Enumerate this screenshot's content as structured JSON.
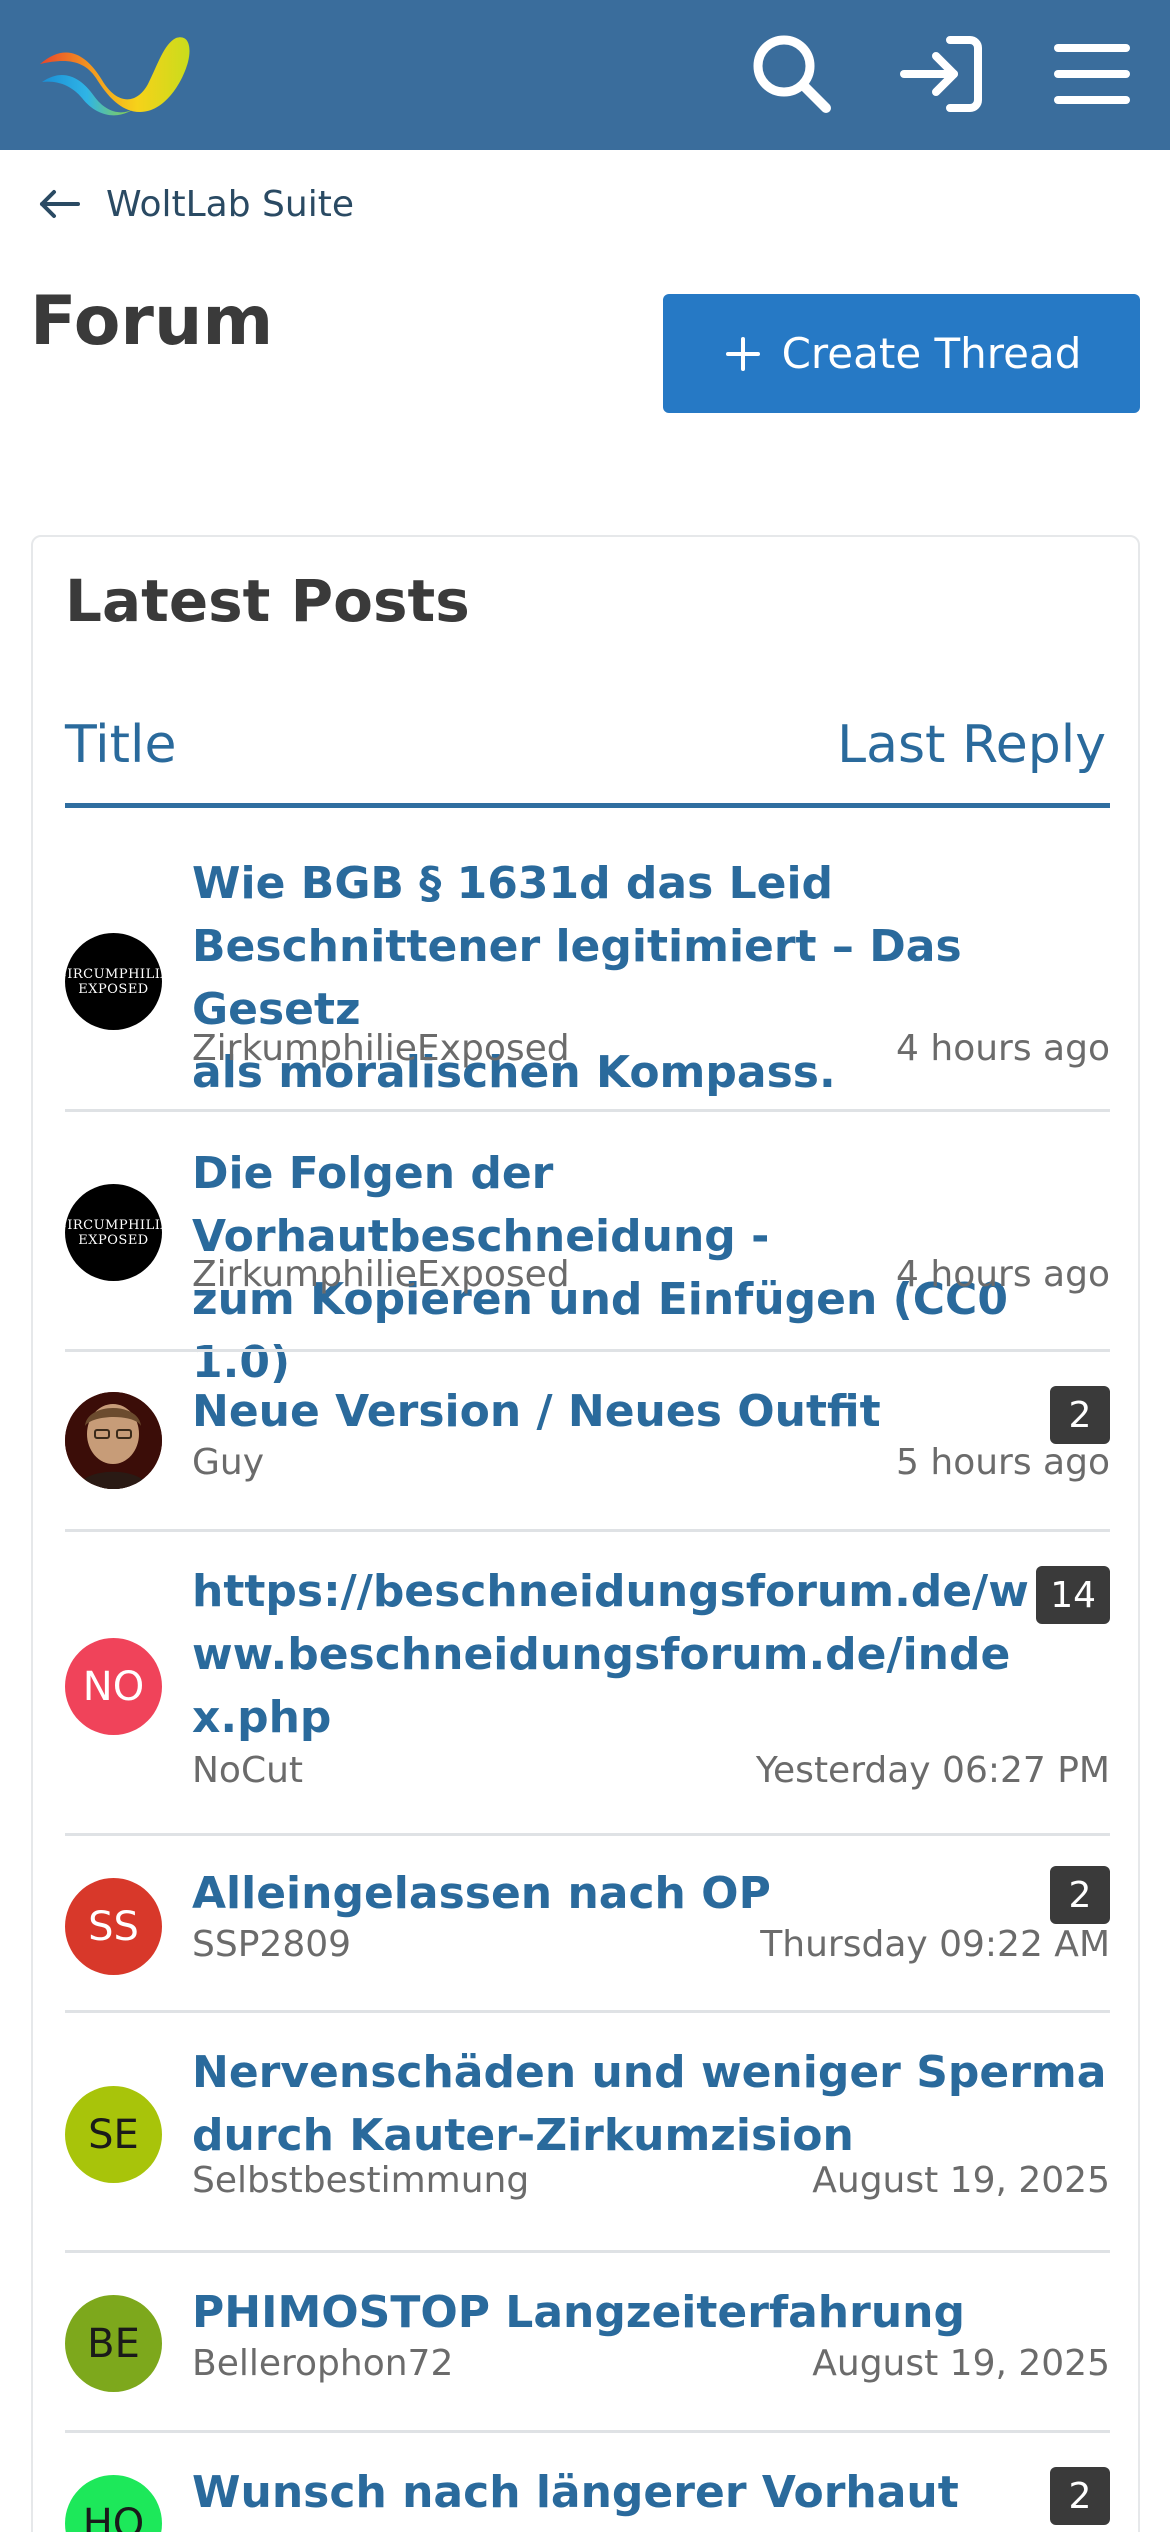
{
  "header": {
    "icons": {
      "logo": "woltlab-logo",
      "search": "search-icon",
      "login": "login-icon",
      "menu": "menu-icon"
    },
    "background_color": "#3a6d9c"
  },
  "breadcrumb": {
    "label": "WoltLab Suite",
    "icon": "arrow-left-icon"
  },
  "page": {
    "title": "Forum",
    "create_button": {
      "label": "Create Thread",
      "icon": "plus-icon",
      "color": "#2679c5"
    }
  },
  "latest_posts": {
    "heading": "Latest Posts",
    "columns": {
      "title": "Title",
      "last_reply": "Last Reply"
    },
    "threads": [
      {
        "title_lines": [
          "Wie BGB § 1631d das Leid",
          "Beschnittener legitimiert – Das Gesetz",
          "als moralischen Kompass."
        ],
        "author": "ZirkumphilieExposed",
        "time": "4 hours ago",
        "replies": "",
        "avatar": {
          "type": "logo",
          "line1": "CIRCUMPHILIA",
          "line2": "EXPOSED"
        }
      },
      {
        "title_lines": [
          "Die Folgen der Vorhautbeschneidung -",
          "zum Kopieren und Einfügen (CC0 1.0)"
        ],
        "author": "ZirkumphilieExposed",
        "time": "4 hours ago",
        "replies": "",
        "avatar": {
          "type": "logo",
          "line1": "CIRCUMPHILIA",
          "line2": "EXPOSED"
        }
      },
      {
        "title_lines": [
          "Neue Version / Neues Outfit"
        ],
        "author": "Guy",
        "time": "5 hours ago",
        "replies": "2",
        "avatar": {
          "type": "photo"
        }
      },
      {
        "title_lines": [
          "https://beschneidungsforum.de/w",
          "ww.beschneidungsforum.de/inde",
          "x.php"
        ],
        "author": "NoCut",
        "time": "Yesterday 06:27 PM",
        "replies": "14",
        "avatar": {
          "type": "initials",
          "text": "NO",
          "bg": "#f0435a",
          "fg": "#ffffff"
        }
      },
      {
        "title_lines": [
          "Alleingelassen nach OP"
        ],
        "author": "SSP2809",
        "time": "Thursday 09:22 AM",
        "replies": "2",
        "avatar": {
          "type": "initials",
          "text": "SS",
          "bg": "#d8382a",
          "fg": "#ffffff"
        }
      },
      {
        "title_lines": [
          "Nervenschäden und weniger Sperma",
          "durch Kauter-Zirkumzision"
        ],
        "author": "Selbstbestimmung",
        "time": "August 19, 2025",
        "replies": "",
        "avatar": {
          "type": "initials",
          "text": "SE",
          "bg": "#a8c40a",
          "fg": "#1a1a1a"
        }
      },
      {
        "title_lines": [
          "PHIMOSTOP Langzeiterfahrung"
        ],
        "author": "Bellerophon72",
        "time": "August 19, 2025",
        "replies": "",
        "avatar": {
          "type": "initials",
          "text": "BE",
          "bg": "#7da81c",
          "fg": "#1a1a1a"
        }
      },
      {
        "title_lines": [
          "Wunsch nach längerer Vorhaut"
        ],
        "author": "",
        "time": "",
        "replies": "2",
        "avatar": {
          "type": "initials",
          "text": "HO",
          "bg": "#1de85a",
          "fg": "#1a1a1a"
        }
      }
    ]
  }
}
